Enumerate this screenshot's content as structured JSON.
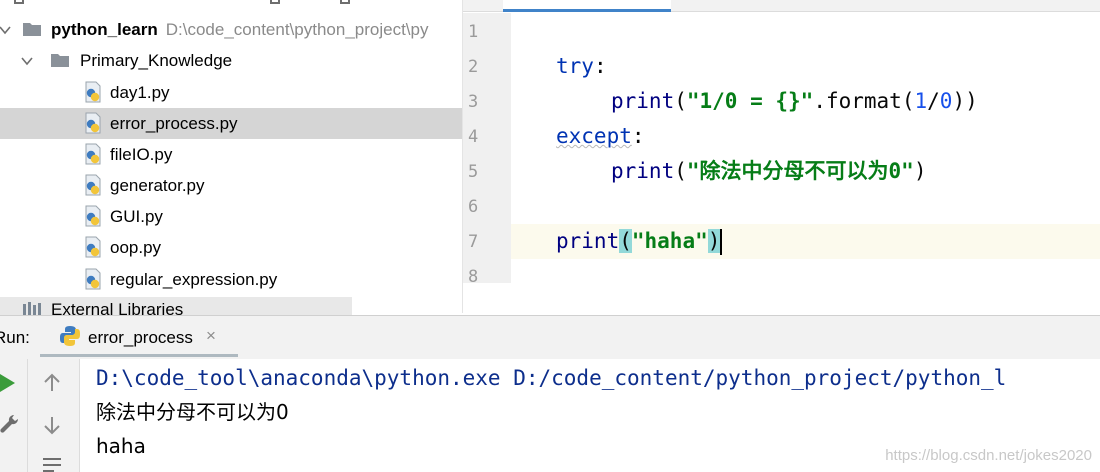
{
  "project_tree": {
    "root": {
      "name": "python_learn",
      "path": "D:\\code_content\\python_project\\py"
    },
    "folder": "Primary_Knowledge",
    "files": [
      "day1.py",
      "error_process.py",
      "fileIO.py",
      "generator.py",
      "GUI.py",
      "oop.py",
      "regular_expression.py"
    ],
    "selected_file": "error_process.py",
    "external_libraries": "External Libraries"
  },
  "editor": {
    "line_numbers": [
      "1",
      "2",
      "3",
      "4",
      "5",
      "6",
      "7",
      "8"
    ],
    "code": {
      "l2_kw": "try",
      "l2_punct": ":",
      "l3_fn": "print",
      "l3_open": "(",
      "l3_str": "\"1/0 = {}\"",
      "l3_method": ".format(",
      "l3_num1": "1",
      "l3_div": "/",
      "l3_num2": "0",
      "l3_close": "))",
      "l4_kw": "except",
      "l4_punct": ":",
      "l5_fn": "print",
      "l5_open": "(",
      "l5_str": "\"除法中分母不可以为0\"",
      "l5_close": ")",
      "l7_fn": "print",
      "l7_open": "(",
      "l7_str": "\"haha\"",
      "l7_close": ")"
    },
    "current_line": "7"
  },
  "run_panel": {
    "label": "Run:",
    "tab_name": "error_process",
    "close_glyph": "×",
    "output": [
      "D:\\code_tool\\anaconda\\python.exe D:/code_content/python_project/python_l",
      "除法中分母不可以为0",
      "haha"
    ]
  },
  "watermark": "https://blog.csdn.net/jokes2020",
  "colors": {
    "keyword": "#0033b3",
    "string": "#067d17",
    "number": "#1750eb",
    "selection": "#d5d5d5",
    "brace_highlight": "#93d9d9",
    "tab_underline": "#4083c9"
  }
}
